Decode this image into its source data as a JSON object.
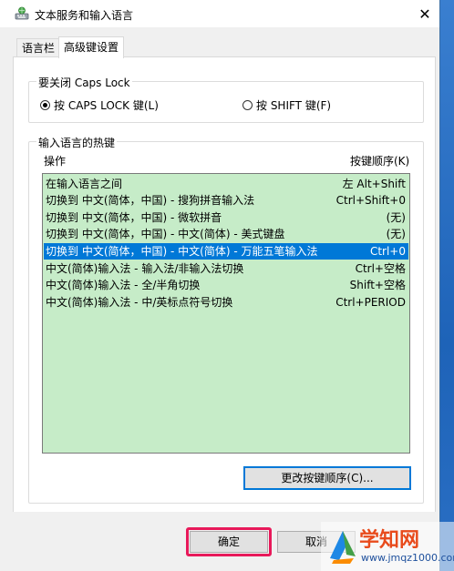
{
  "window": {
    "title": "文本服务和输入语言",
    "close_glyph": "✕"
  },
  "tabs": [
    {
      "label": "语言栏",
      "active": false
    },
    {
      "label": "高级键设置",
      "active": true
    }
  ],
  "caps_lock_group": {
    "legend": "要关闭 Caps Lock",
    "options": [
      {
        "label": "按 CAPS LOCK 键(L)",
        "checked": true
      },
      {
        "label": "按 SHIFT 键(F)",
        "checked": false
      }
    ]
  },
  "hotkeys_group": {
    "legend": "输入语言的热键",
    "col_action": "操作",
    "col_sequence": "按键顺序(K)",
    "rows": [
      {
        "action": "在输入语言之间",
        "keys": "左 Alt+Shift",
        "selected": false
      },
      {
        "action": "切换到 中文(简体，中国) - 搜狗拼音输入法",
        "keys": "Ctrl+Shift+0",
        "selected": false
      },
      {
        "action": "切换到 中文(简体，中国) - 微软拼音",
        "keys": "(无)",
        "selected": false
      },
      {
        "action": "切换到 中文(简体，中国) - 中文(简体) - 美式键盘",
        "keys": "(无)",
        "selected": false
      },
      {
        "action": "切换到 中文(简体，中国) - 中文(简体) - 万能五笔输入法",
        "keys": "Ctrl+0",
        "selected": true
      },
      {
        "action": "中文(简体)输入法 - 输入法/非输入法切换",
        "keys": "Ctrl+空格",
        "selected": false
      },
      {
        "action": "中文(简体)输入法 - 全/半角切换",
        "keys": "Shift+空格",
        "selected": false
      },
      {
        "action": "中文(简体)输入法 - 中/英标点符号切换",
        "keys": "Ctrl+PERIOD",
        "selected": false
      }
    ],
    "change_button": "更改按键顺序(C)..."
  },
  "buttons": {
    "ok": "确定",
    "cancel": "取消"
  },
  "watermark": {
    "title": "学知网",
    "url": "www.jmqz1000.com"
  },
  "colors": {
    "list_bg": "#c6ecc8",
    "selection": "#0078d7",
    "highlight": "#e8195a"
  }
}
